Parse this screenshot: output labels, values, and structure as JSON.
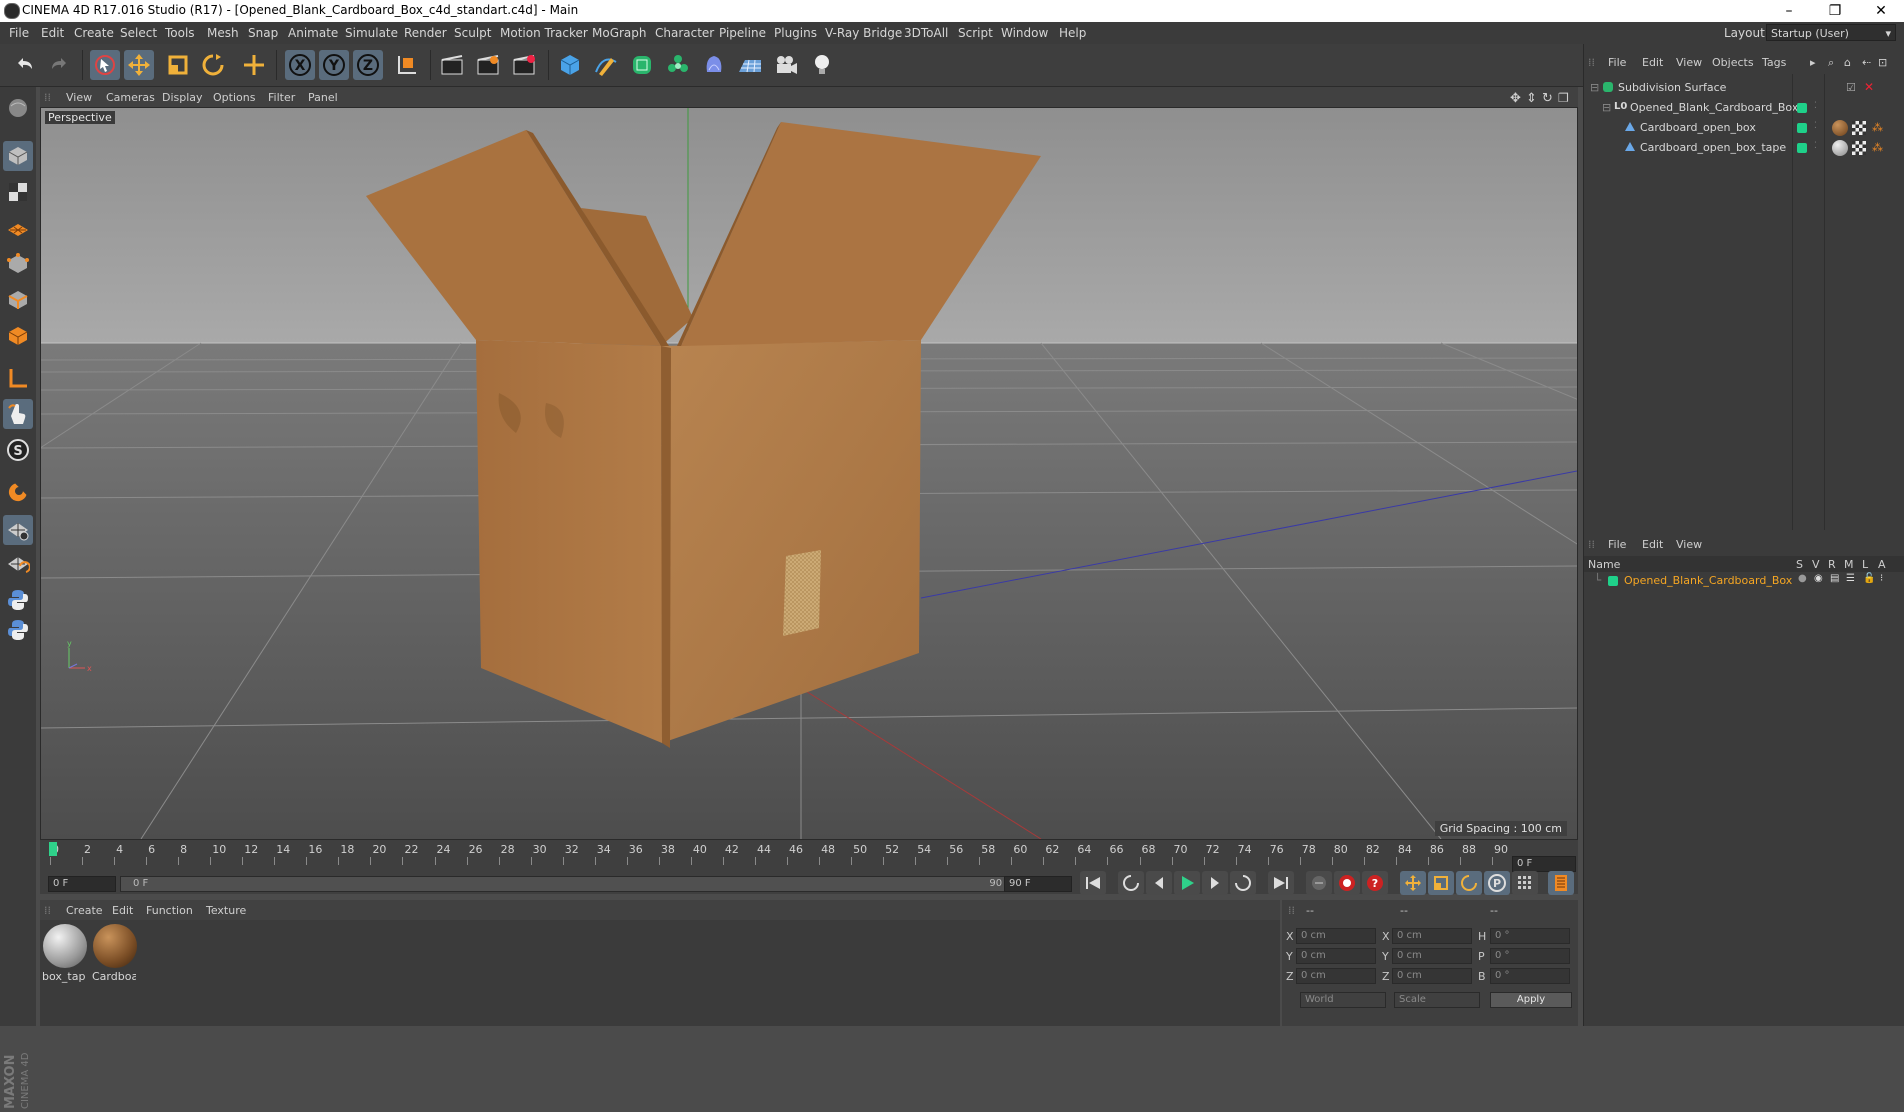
{
  "window": {
    "title": "CINEMA 4D R17.016 Studio (R17) - [Opened_Blank_Cardboard_Box_c4d_standart.c4d] - Main",
    "minimize": "–",
    "maximize": "❐",
    "close": "✕"
  },
  "menubar": {
    "items": [
      "File",
      "Edit",
      "Create",
      "Select",
      "Tools",
      "Mesh",
      "Snap",
      "Animate",
      "Simulate",
      "Render",
      "Sculpt",
      "Motion Tracker",
      "MoGraph",
      "Character",
      "Pipeline",
      "Plugins",
      "V-Ray Bridge",
      "3DToAll",
      "Script",
      "Window",
      "Help"
    ],
    "layout_label": "Layout:",
    "layout_value": "Startup (User)"
  },
  "toolbar": {
    "icons": [
      "undo-icon",
      "redo-icon",
      "live-selection-icon",
      "move-icon",
      "scale-icon",
      "rotate-icon",
      "recent-tool-icon",
      "x-axis-icon",
      "y-axis-icon",
      "z-axis-icon",
      "coordinate-system-icon",
      "render-view-icon",
      "render-picture-viewer-icon",
      "edit-render-settings-icon",
      "cube-primitive-icon",
      "pen-spline-icon",
      "subdivision-surface-icon",
      "cloner-icon",
      "deformer-icon",
      "floor-icon",
      "camera-icon",
      "light-icon"
    ],
    "axis_labels": {
      "x": "X",
      "y": "Y",
      "z": "Z"
    }
  },
  "leftbar": {
    "icons": [
      "model-mode-icon",
      "texture-mode-icon",
      "workplane-mode-icon",
      "points-mode-icon",
      "edges-mode-icon",
      "polygons-mode-icon",
      "axis-mode-icon",
      "tweak-mode-icon",
      "solo-mode-icon",
      "snap-icon",
      "workplane-lock-icon",
      "enable-snapping-icon",
      "python-icon",
      "python-script-icon"
    ],
    "brand_line1": "MAXON",
    "brand_line2": "CINEMA 4D"
  },
  "viewport": {
    "menu": [
      "View",
      "Cameras",
      "Display",
      "Options",
      "Filter",
      "Panel"
    ],
    "label": "Perspective",
    "grid_spacing": "Grid Spacing : 100 cm",
    "axis_x": "x",
    "axis_y": "y"
  },
  "timeline": {
    "ticks": [
      "0",
      "2",
      "4",
      "6",
      "8",
      "10",
      "12",
      "14",
      "16",
      "18",
      "20",
      "22",
      "24",
      "26",
      "28",
      "30",
      "32",
      "34",
      "36",
      "38",
      "40",
      "42",
      "44",
      "46",
      "48",
      "50",
      "52",
      "54",
      "56",
      "58",
      "60",
      "62",
      "64",
      "66",
      "68",
      "70",
      "72",
      "74",
      "76",
      "78",
      "80",
      "82",
      "84",
      "86",
      "88",
      "90"
    ],
    "current_frame_right": "0 F",
    "start_frame": "0 F",
    "slider_start": "0 F",
    "slider_end": "90 F",
    "end_frame": "90 F"
  },
  "playback": {
    "icons": [
      "go-to-start-icon",
      "play-backwards-icon",
      "previous-frame-icon",
      "play-forward-icon",
      "next-frame-icon",
      "go-to-end-icon",
      "loop-icon",
      "keyframe-record-icon",
      "autokey-icon",
      "keyframe-selection-icon",
      "move-key-icon",
      "scale-key-icon",
      "rotate-key-icon",
      "param-key-icon",
      "pla-key-icon",
      "timeline-window-icon"
    ]
  },
  "material_manager": {
    "menu": [
      "Create",
      "Edit",
      "Function",
      "Texture"
    ],
    "materials": [
      {
        "name": "box_tap",
        "color": "#bdbdbd"
      },
      {
        "name": "Cardboa",
        "color": "#8a5a2e"
      }
    ]
  },
  "coordinates": {
    "header": [
      "--",
      "--",
      "--"
    ],
    "rows": [
      {
        "pos_label": "X",
        "pos": "0 cm",
        "size_label": "X",
        "size": "0 cm",
        "rot_label": "H",
        "rot": "0 °"
      },
      {
        "pos_label": "Y",
        "pos": "0 cm",
        "size_label": "Y",
        "size": "0 cm",
        "rot_label": "P",
        "rot": "0 °"
      },
      {
        "pos_label": "Z",
        "pos": "0 cm",
        "size_label": "Z",
        "size": "0 cm",
        "rot_label": "B",
        "rot": "0 °"
      }
    ],
    "world": "World",
    "scale": "Scale",
    "apply": "Apply"
  },
  "object_manager": {
    "menu": [
      "File",
      "Edit",
      "View",
      "Objects",
      "Tags"
    ],
    "objects": [
      {
        "name": "Subdivision Surface",
        "type": "subdivision-surface-icon"
      },
      {
        "name": "Opened_Blank_Cardboard_Box",
        "type": "null-object-icon"
      },
      {
        "name": "Cardboard_open_box",
        "type": "polygon-object-icon"
      },
      {
        "name": "Cardboard_open_box_tape",
        "type": "polygon-object-icon"
      }
    ]
  },
  "attribute_manager": {
    "menu": [
      "File",
      "Edit",
      "View"
    ],
    "columns": [
      "Name",
      "S",
      "V",
      "R",
      "M",
      "L",
      "A"
    ],
    "layer_name": "Opened_Blank_Cardboard_Box"
  },
  "colors": {
    "accent_green": "#1fd18a",
    "highlight_orange": "#f5a623",
    "active_tool": "#5a6c7d"
  }
}
